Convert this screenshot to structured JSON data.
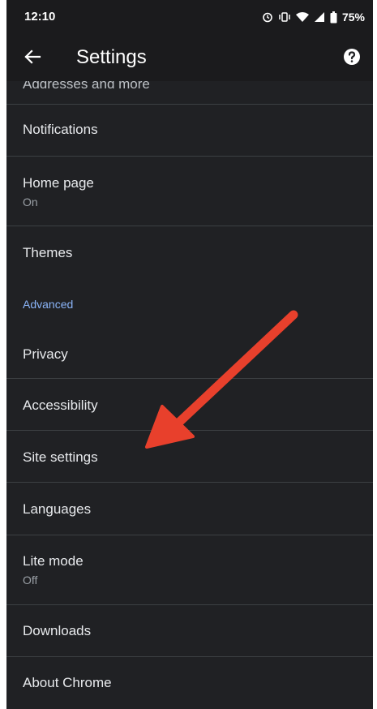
{
  "status_bar": {
    "time": "12:10",
    "battery": "75%"
  },
  "app_bar": {
    "title": "Settings"
  },
  "list": {
    "cut_off_item": "Addresses and more",
    "items": [
      {
        "title": "Notifications"
      },
      {
        "title": "Home page",
        "subtitle": "On"
      },
      {
        "title": "Themes"
      },
      {
        "section": "Advanced"
      },
      {
        "title": "Privacy"
      },
      {
        "title": "Accessibility"
      },
      {
        "title": "Site settings"
      },
      {
        "title": "Languages"
      },
      {
        "title": "Lite mode",
        "subtitle": "Off"
      },
      {
        "title": "Downloads"
      },
      {
        "title": "About Chrome"
      }
    ]
  },
  "colors": {
    "background": "#202124",
    "accent": "#8ab4f8",
    "annotation_arrow": "#e8402c"
  },
  "icons": {
    "back": "arrow-back-icon",
    "help": "help-icon"
  }
}
